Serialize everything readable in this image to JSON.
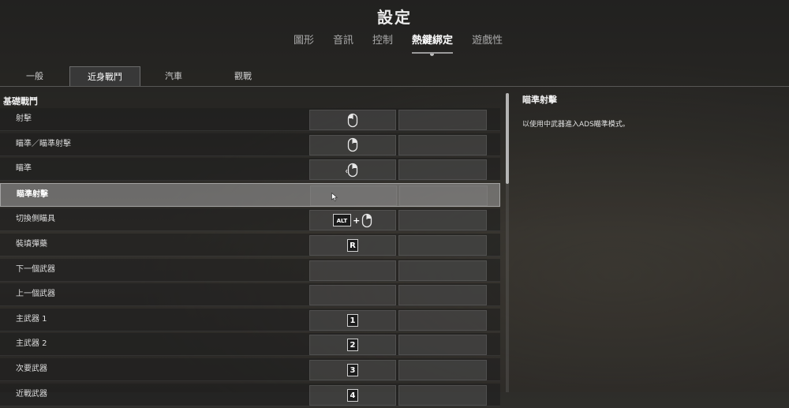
{
  "header": {
    "title": "設定"
  },
  "main_tabs": [
    {
      "label": "圖形"
    },
    {
      "label": "音訊"
    },
    {
      "label": "控制"
    },
    {
      "label": "熱鍵綁定"
    },
    {
      "label": "遊戲性"
    }
  ],
  "sub_tabs": [
    {
      "label": "一般"
    },
    {
      "label": "近身戰鬥"
    },
    {
      "label": "汽車"
    },
    {
      "label": "觀戰"
    }
  ],
  "section": {
    "title": "基礎戰鬥"
  },
  "bindings": [
    {
      "label": "射擊",
      "key_icon": "mouse-left-icon"
    },
    {
      "label": "瞄準／瞄準射擊",
      "key_icon": "mouse-right-icon"
    },
    {
      "label": "瞄準",
      "key_icon": "mouse-right-hold-icon"
    },
    {
      "label": "瞄準射擊"
    },
    {
      "label": "切換側瞄具",
      "modifier": "ALT",
      "plus": "+",
      "key_icon": "mouse-right-icon"
    },
    {
      "label": "裝填彈藥",
      "key": "R"
    },
    {
      "label": "下一個武器"
    },
    {
      "label": "上一個武器"
    },
    {
      "label": "主武器 1",
      "key": "1"
    },
    {
      "label": "主武器 2",
      "key": "2"
    },
    {
      "label": "次要武器",
      "key": "3"
    },
    {
      "label": "近戰武器",
      "key": "4"
    }
  ],
  "description": {
    "title": "瞄準射擊",
    "text": "以使用中武器進入ADS瞄準模式。"
  }
}
